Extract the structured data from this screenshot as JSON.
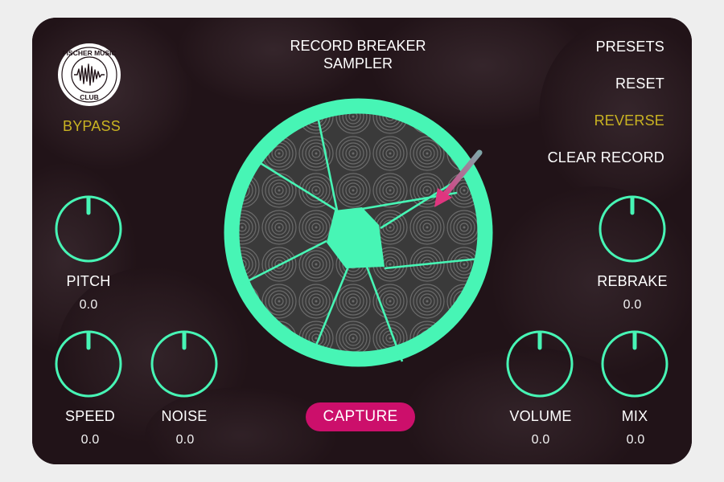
{
  "brand": {
    "logo_text": "FISCHER MUSIC CLUB"
  },
  "header": {
    "title_line1": "RECORD BREAKER",
    "title_line2": "SAMPLER"
  },
  "menu": {
    "presets": "PRESETS",
    "reset": "RESET",
    "reverse": "REVERSE",
    "clear_record": "CLEAR RECORD"
  },
  "bypass": "BYPASS",
  "capture": "CAPTURE",
  "knobs": {
    "pitch": {
      "label": "PITCH",
      "value": "0.0"
    },
    "speed": {
      "label": "SPEED",
      "value": "0.0"
    },
    "noise": {
      "label": "NOISE",
      "value": "0.0"
    },
    "rebrake": {
      "label": "REBRAKE",
      "value": "0.0"
    },
    "volume": {
      "label": "VOLUME",
      "value": "0.0"
    },
    "mix": {
      "label": "MIX",
      "value": "0.0"
    }
  },
  "colors": {
    "accent": "#47f5b5",
    "active": "#c9b322",
    "capture": "#cc0f6b",
    "arrow": "#e0357f",
    "panel": "#211318"
  },
  "icons": {
    "arrow": "pink-arrow-icon",
    "logo": "waveform-logo-icon"
  }
}
